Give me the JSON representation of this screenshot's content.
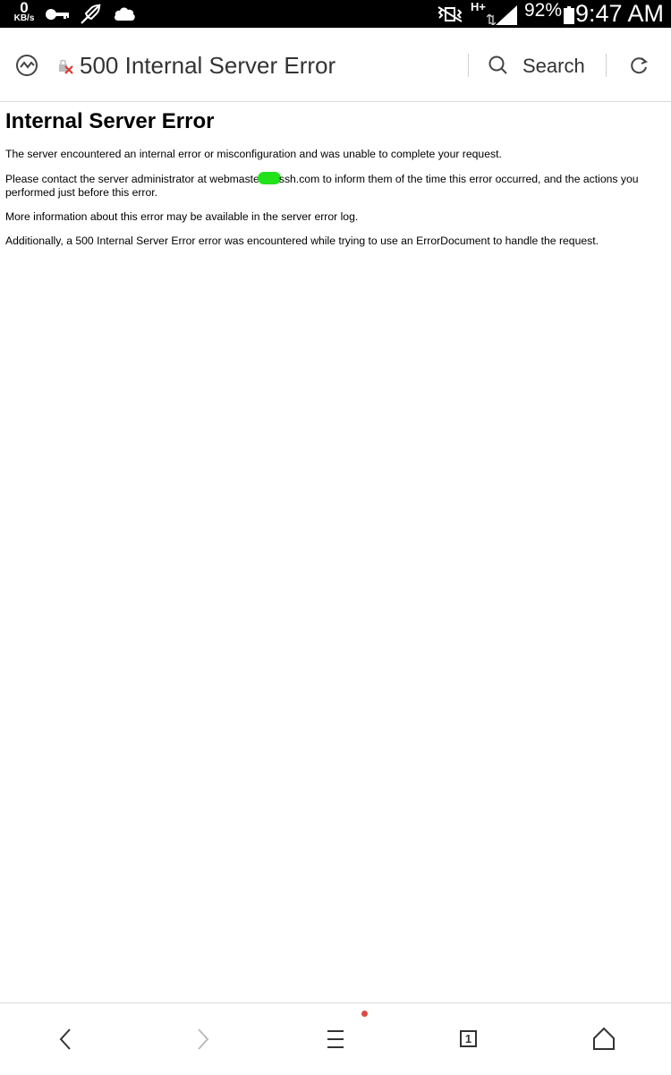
{
  "status_bar": {
    "net_speed_value": "0",
    "net_speed_unit": "KB/s",
    "network_type": "H+",
    "battery": "92%",
    "time": "9:47 AM"
  },
  "address_bar": {
    "title": "500 Internal Server Error",
    "search_label": "Search"
  },
  "content": {
    "heading": "Internal Server Error",
    "p1": "The server encountered an internal error or misconfiguration and was unable to complete your request.",
    "p2_before": "Please contact the server administrator at webmaste",
    "p2_after": "ssh.com to inform them of the time this error occurred, and the actions you performed just before this error.",
    "p3": "More information about this error may be available in the server error log.",
    "p4": "Additionally, a 500 Internal Server Error error was encountered while trying to use an ErrorDocument to handle the request."
  },
  "bottom_bar": {
    "tab_count": "1"
  },
  "colors": {
    "status_bar_bg": "#000000",
    "notification_dot": "#d94c43",
    "redaction": "#22e21a"
  }
}
